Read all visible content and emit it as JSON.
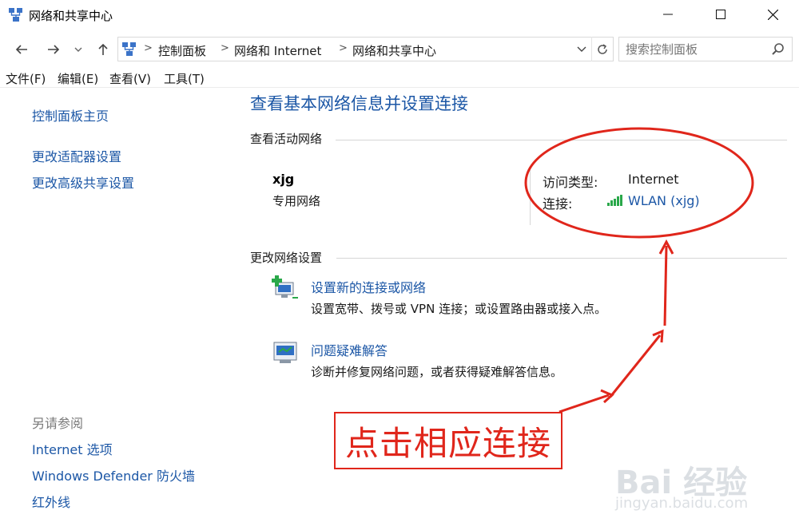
{
  "window": {
    "title": "网络和共享中心",
    "minimize_glyph": "—",
    "maximize_glyph": "☐",
    "close_glyph": "✕"
  },
  "nav": {
    "breadcrumbs": [
      "控制面板",
      "网络和 Internet",
      "网络和共享中心"
    ],
    "search_placeholder": "搜索控制面板"
  },
  "menu": [
    "文件(F)",
    "编辑(E)",
    "查看(V)",
    "工具(T)"
  ],
  "sidebar": {
    "links": [
      "控制面板主页",
      "更改适配器设置",
      "更改高级共享设置"
    ],
    "see_also_header": "另请参阅",
    "see_also": [
      "Internet 选项",
      "Windows Defender 防火墙",
      "红外线"
    ]
  },
  "main": {
    "title": "查看基本网络信息并设置连接",
    "active_header": "查看活动网络",
    "network": {
      "name": "xjg",
      "type": "专用网络",
      "access_label": "访问类型:",
      "access_value": "Internet",
      "connection_label": "连接:",
      "connection_value": "WLAN (xjg)"
    },
    "change_header": "更改网络设置",
    "tasks": [
      {
        "link": "设置新的连接或网络",
        "desc": "设置宽带、拨号或 VPN 连接；或设置路由器或接入点。"
      },
      {
        "link": "问题疑难解答",
        "desc": "诊断并修复网络问题，或者获得疑难解答信息。"
      }
    ]
  },
  "annotation": {
    "callout_text": "点击相应连接",
    "color": "#e0261b"
  },
  "watermark": {
    "main": "Bai 经验",
    "sub": "jingyan.baidu.com"
  },
  "colors": {
    "link": "#1c57a6",
    "signal": "#2aa84a"
  }
}
